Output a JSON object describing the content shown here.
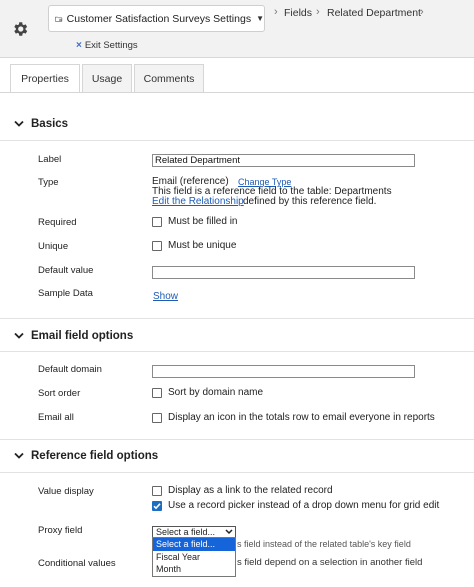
{
  "header": {
    "settings_title": "Customer Satisfaction Surveys Settings",
    "breadcrumb": [
      "Fields",
      "Related Department"
    ],
    "exit_label": "Exit Settings"
  },
  "tabs": [
    {
      "label": "Properties",
      "active": true
    },
    {
      "label": "Usage",
      "active": false
    },
    {
      "label": "Comments",
      "active": false
    }
  ],
  "basics": {
    "title": "Basics",
    "label_label": "Label",
    "label_value": "Related Department",
    "type_label": "Type",
    "type_value": "Email (reference)",
    "change_type": "Change Type",
    "type_desc": "This field is a reference field to the table: Departments",
    "edit_relationship": "Edit the Relationship",
    "edit_relationship_suffix": " defined by this reference field.",
    "required_label": "Required",
    "required_text": "Must be filled in",
    "unique_label": "Unique",
    "unique_text": "Must be unique",
    "default_value_label": "Default value",
    "default_value": "",
    "sample_data_label": "Sample Data",
    "show_link": "Show"
  },
  "email_options": {
    "title": "Email field options",
    "default_domain_label": "Default domain",
    "default_domain": "",
    "sort_order_label": "Sort order",
    "sort_order_text": "Sort by domain name",
    "email_all_label": "Email all",
    "email_all_text": "Display an icon in the totals row to email everyone in reports"
  },
  "reference_options": {
    "title": "Reference field options",
    "value_display_label": "Value display",
    "display_link_text": "Display as a link to the related record",
    "record_picker_text": "Use a record picker instead of a drop down menu for grid edit",
    "record_picker_checked": true,
    "proxy_label": "Proxy field",
    "proxy_selected": "Select a field...",
    "proxy_behind_text": "s field instead of the related table's key field",
    "conditional_label": "Conditional values",
    "conditional_behind_text": "s field depend on a selection in another field",
    "proxy_options": [
      "Select a field...",
      "Fiscal Year",
      "Month"
    ]
  },
  "colors": {
    "accent": "#1f5bb5",
    "selected_option": "#1664d9"
  }
}
